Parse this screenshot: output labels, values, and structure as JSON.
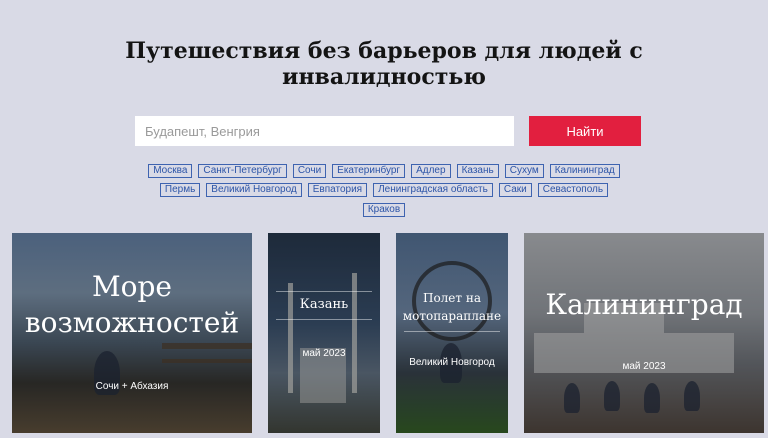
{
  "hero": {
    "title_line1": "Путешествия без барьеров для людей с",
    "title_line2": "инвалидностью"
  },
  "search": {
    "placeholder": "Будапешт, Венгрия",
    "button_label": "Найти"
  },
  "tags": {
    "row1": [
      "Москва",
      "Санкт-Петербург",
      "Сочи",
      "Екатеринбург",
      "Адлер",
      "Казань",
      "Сухум",
      "Калининград"
    ],
    "row2": [
      "Пермь",
      "Великий Новгород",
      "Евпатория",
      "Ленинградская область",
      "Саки",
      "Севастополь"
    ],
    "row3": [
      "Краков"
    ]
  },
  "cards": [
    {
      "title_line1": "Море",
      "title_line2": "возможностей",
      "subtitle": "Сочи + Абхазия"
    },
    {
      "title": "Казань",
      "subtitle": "май 2023"
    },
    {
      "title_line1": "Полет на",
      "title_line2": "мотопараплане",
      "subtitle": "Великий Новгород"
    },
    {
      "title": "Калининград",
      "subtitle": "май 2023"
    }
  ]
}
